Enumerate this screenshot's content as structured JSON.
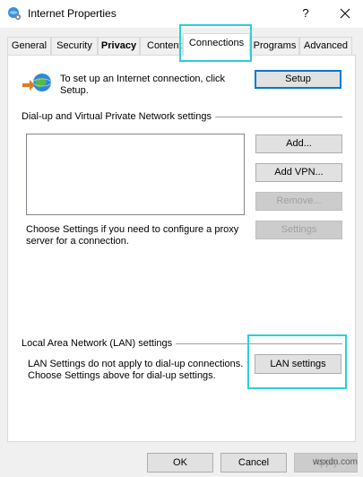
{
  "window": {
    "title": "Internet Properties",
    "help_label": "?",
    "icon": "globe-settings-icon"
  },
  "tabs": [
    {
      "label": "General"
    },
    {
      "label": "Security"
    },
    {
      "label": "Privacy"
    },
    {
      "label": "Content"
    },
    {
      "label": "Connections"
    },
    {
      "label": "Programs"
    },
    {
      "label": "Advanced"
    }
  ],
  "active_tab": "Connections",
  "intro": {
    "text": "To set up an Internet connection, click Setup.",
    "setup_button": "Setup"
  },
  "dialup": {
    "section_label": "Dial-up and Virtual Private Network settings",
    "add_button": "Add...",
    "add_vpn_button": "Add VPN...",
    "remove_button": "Remove...",
    "settings_button": "Settings",
    "proxy_text": "Choose Settings if you need to configure a proxy server for a connection."
  },
  "lan": {
    "section_label": "Local Area Network (LAN) settings",
    "text_line1": "LAN Settings do not apply to dial-up connections.",
    "text_line2": "Choose Settings above for dial-up settings.",
    "button": "LAN settings"
  },
  "footer": {
    "ok_button": "OK",
    "cancel_button": "Cancel",
    "apply_button": "Apply"
  },
  "watermark": "wsxdn.com",
  "colors": {
    "highlight": "#2bd0d6",
    "focus_border": "#0078d7"
  }
}
